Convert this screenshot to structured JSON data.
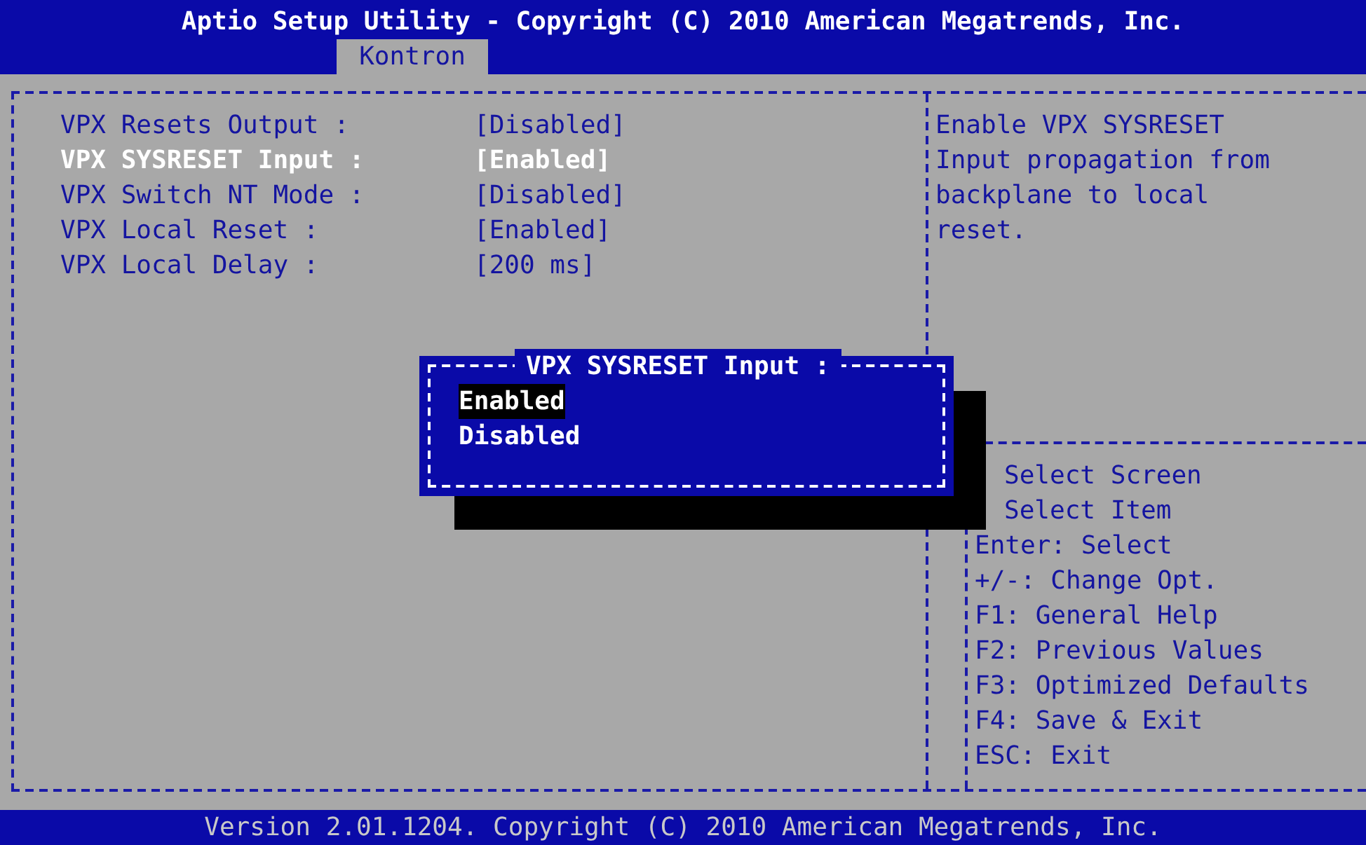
{
  "header": {
    "title": "Aptio Setup Utility - Copyright (C) 2010 American Megatrends, Inc.",
    "tabs": [
      {
        "label": "Kontron",
        "selected": true
      }
    ]
  },
  "settings": [
    {
      "label": "VPX Resets Output :",
      "value": "[Disabled]",
      "selected": false
    },
    {
      "label": "VPX SYSRESET Input :",
      "value": "[Enabled]",
      "selected": true
    },
    {
      "label": "VPX Switch NT Mode :",
      "value": "[Disabled]",
      "selected": false
    },
    {
      "label": "VPX Local Reset :",
      "value": "[Enabled]",
      "selected": false
    },
    {
      "label": "VPX Local Delay :",
      "value": "[200 ms]",
      "selected": false
    }
  ],
  "help_text": "Enable VPX SYSRESET Input propagation from backplane to local reset.",
  "key_help": [
    "Select Screen",
    "Select Item",
    "Enter: Select",
    "+/-: Change Opt.",
    "F1: General Help",
    "F2: Previous Values",
    "F3: Optimized Defaults",
    "F4: Save & Exit",
    "ESC: Exit"
  ],
  "popup": {
    "title": "VPX SYSRESET Input :",
    "options": [
      {
        "label": "Enabled",
        "selected": true
      },
      {
        "label": "Disabled",
        "selected": false
      }
    ]
  },
  "footer": "Version 2.01.1204. Copyright (C) 2010 American Megatrends, Inc."
}
